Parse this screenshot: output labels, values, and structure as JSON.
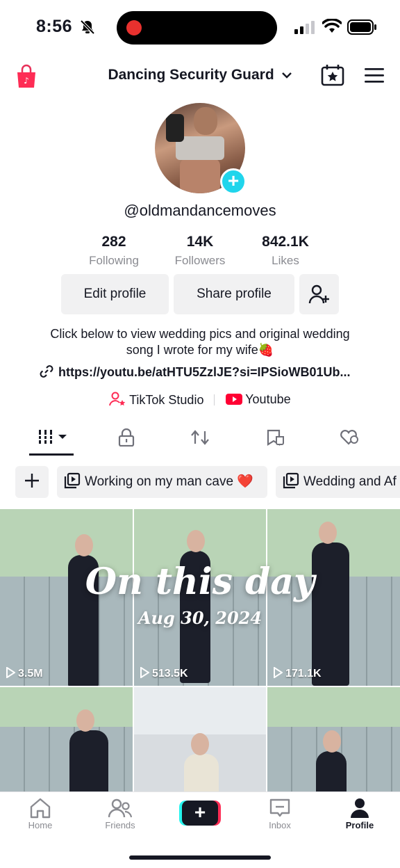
{
  "status_bar": {
    "time": "8:56"
  },
  "header": {
    "account_name": "Dancing Security Guard"
  },
  "profile": {
    "username": "@oldmandancemoves",
    "stats": [
      {
        "value": "282",
        "label": "Following"
      },
      {
        "value": "14K",
        "label": "Followers"
      },
      {
        "value": "842.1K",
        "label": "Likes"
      }
    ],
    "buttons": {
      "edit": "Edit profile",
      "share": "Share profile"
    },
    "bio": "Click below to view wedding pics and original wedding song I wrote for my wife🍓",
    "link": "https://youtu.be/atHTU5ZzlJE?si=IPSioWB01Ub...",
    "extras": {
      "studio": "TikTok Studio",
      "youtube": "Youtube"
    }
  },
  "collections": [
    {
      "label": "Working on my man cave ❤️"
    },
    {
      "label": "Wedding and Af"
    }
  ],
  "videos": [
    {
      "views": "3.5M"
    },
    {
      "views": "513.5K"
    },
    {
      "views": "171.1K"
    },
    {
      "views": ""
    },
    {
      "views": ""
    },
    {
      "views": ""
    }
  ],
  "on_this_day": {
    "title": "On this day",
    "date": "Aug 30, 2024"
  },
  "bottom_nav": [
    {
      "label": "Home"
    },
    {
      "label": "Friends"
    },
    {
      "label": "Inbox"
    },
    {
      "label": "Profile"
    }
  ],
  "colors": {
    "accent": "#fe2c55",
    "cyan": "#25f4ee",
    "badge": "#20d5ec",
    "youtube": "#ff0033"
  },
  "icons": [
    "muted-bell-icon",
    "signal-icon",
    "wifi-icon",
    "battery-icon",
    "shop-bag-icon",
    "chevron-down-icon",
    "calendar-star-icon",
    "hamburger-menu-icon",
    "add-friend-icon",
    "link-icon",
    "tiktok-studio-icon",
    "youtube-icon",
    "grid-videos-icon",
    "lock-icon",
    "repost-icon",
    "favorites-icon",
    "liked-icon",
    "add-collection-icon",
    "collection-icon",
    "play-icon",
    "home-icon",
    "friends-icon",
    "create-icon",
    "inbox-icon",
    "profile-icon"
  ]
}
